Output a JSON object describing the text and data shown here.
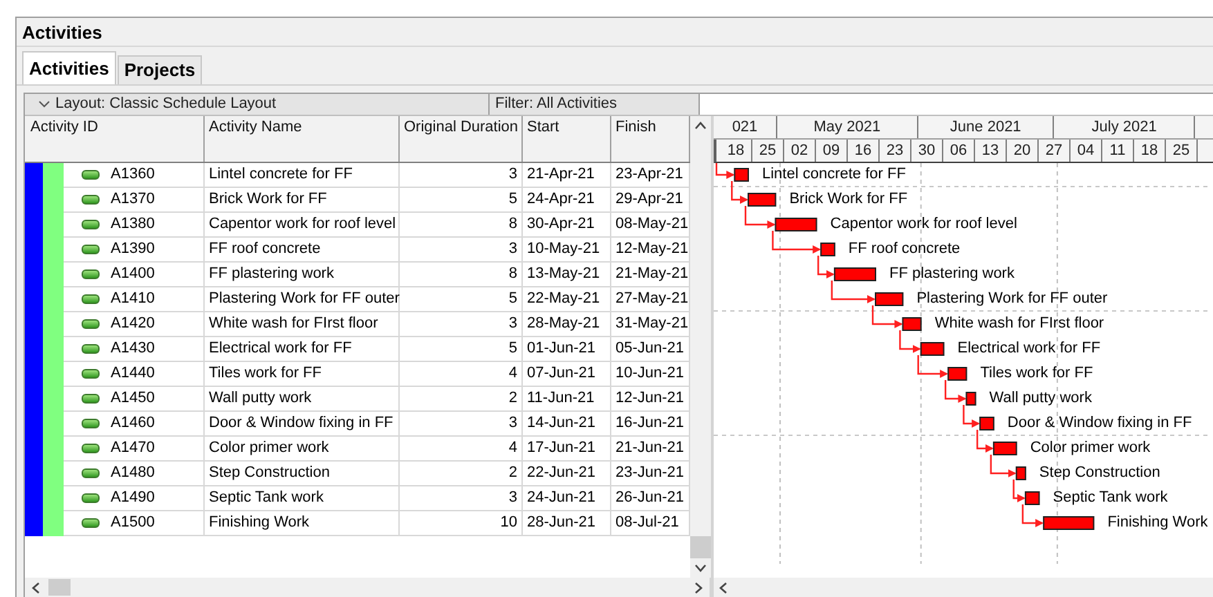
{
  "window": {
    "title": "Activities"
  },
  "tabs": [
    {
      "label": "Activities",
      "selected": true
    },
    {
      "label": "Projects",
      "selected": false
    }
  ],
  "layout_bar": {
    "layout": "Layout: Classic Schedule Layout",
    "filter": "Filter: All Activities"
  },
  "table": {
    "columns": [
      "Activity ID",
      "Activity Name",
      "Original Duration",
      "Start",
      "Finish"
    ],
    "rows": [
      {
        "id": "A1360",
        "name": "Lintel concrete for FF",
        "duration": "3",
        "start": "21-Apr-21",
        "finish": "23-Apr-21"
      },
      {
        "id": "A1370",
        "name": "Brick Work for FF",
        "duration": "5",
        "start": "24-Apr-21",
        "finish": "29-Apr-21"
      },
      {
        "id": "A1380",
        "name": "Capentor work for roof level",
        "duration": "8",
        "start": "30-Apr-21",
        "finish": "08-May-21"
      },
      {
        "id": "A1390",
        "name": "FF roof concrete",
        "duration": "3",
        "start": "10-May-21",
        "finish": "12-May-21"
      },
      {
        "id": "A1400",
        "name": "FF plastering work",
        "duration": "8",
        "start": "13-May-21",
        "finish": "21-May-21"
      },
      {
        "id": "A1410",
        "name": "Plastering Work for FF outer",
        "duration": "5",
        "start": "22-May-21",
        "finish": "27-May-21"
      },
      {
        "id": "A1420",
        "name": "White wash for FIrst floor",
        "duration": "3",
        "start": "28-May-21",
        "finish": "31-May-21"
      },
      {
        "id": "A1430",
        "name": "Electrical work for FF",
        "duration": "5",
        "start": "01-Jun-21",
        "finish": "05-Jun-21"
      },
      {
        "id": "A1440",
        "name": "Tiles work for FF",
        "duration": "4",
        "start": "07-Jun-21",
        "finish": "10-Jun-21"
      },
      {
        "id": "A1450",
        "name": "Wall putty work",
        "duration": "2",
        "start": "11-Jun-21",
        "finish": "12-Jun-21"
      },
      {
        "id": "A1460",
        "name": "Door & Window fixing in FF",
        "duration": "3",
        "start": "14-Jun-21",
        "finish": "16-Jun-21"
      },
      {
        "id": "A1470",
        "name": "Color primer work",
        "duration": "4",
        "start": "17-Jun-21",
        "finish": "21-Jun-21"
      },
      {
        "id": "A1480",
        "name": "Step Construction",
        "duration": "2",
        "start": "22-Jun-21",
        "finish": "23-Jun-21"
      },
      {
        "id": "A1490",
        "name": "Septic Tank work",
        "duration": "3",
        "start": "24-Jun-21",
        "finish": "26-Jun-21"
      },
      {
        "id": "A1500",
        "name": "Finishing Work",
        "duration": "10",
        "start": "28-Jun-21",
        "finish": "08-Jul-21"
      }
    ]
  },
  "gantt": {
    "months": [
      "021",
      "May 2021",
      "June 2021",
      "July 2021"
    ],
    "weeks": [
      "18",
      "25",
      "02",
      "09",
      "16",
      "23",
      "30",
      "06",
      "13",
      "20",
      "27",
      "04",
      "11",
      "18",
      "25"
    ],
    "bar_labels": [
      "Lintel concrete for FF",
      "Brick Work for FF",
      "Capentor work for roof level",
      "FF roof concrete",
      "FF plastering work",
      "Plastering Work for FF outer",
      "White wash for FIrst floor",
      "Electrical work for FF",
      "Tiles work for FF",
      "Wall putty work",
      "Door & Window fixing in FF",
      "Color primer work",
      "Step Construction",
      "Septic Tank work",
      "Finishing Work"
    ]
  }
}
